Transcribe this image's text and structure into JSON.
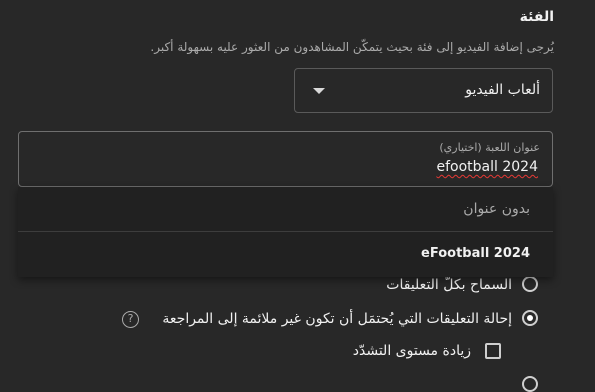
{
  "category": {
    "title": "الفئة",
    "description": "يُرجى إضافة الفيديو إلى فئة بحيث يتمكّن المشاهدون من العثور عليه بسهولة أكبر.",
    "selected": "ألعاب الفيديو",
    "arrow_icon": "dropdown-arrow-icon"
  },
  "game_title": {
    "label": "عنوان اللعبة (اختياري)",
    "value": "efootball 2024"
  },
  "suggestions": [
    {
      "label": "بدون عنوان"
    },
    {
      "label": "eFootball 2024"
    }
  ],
  "comments": {
    "options": [
      {
        "label": "السماح بكلّ التعليقات",
        "checked": false
      },
      {
        "label": "إحالة التعليقات التي يُحتمَل أن تكون غير ملائمة إلى المراجعة",
        "checked": true
      },
      {
        "label": "زيادة مستوى التشدّد",
        "checked": false
      }
    ],
    "help_icon": "?"
  },
  "colors": {
    "background": "#282828",
    "dropdown_bg": "#212121",
    "spellcheck_underline": "#e53935"
  }
}
